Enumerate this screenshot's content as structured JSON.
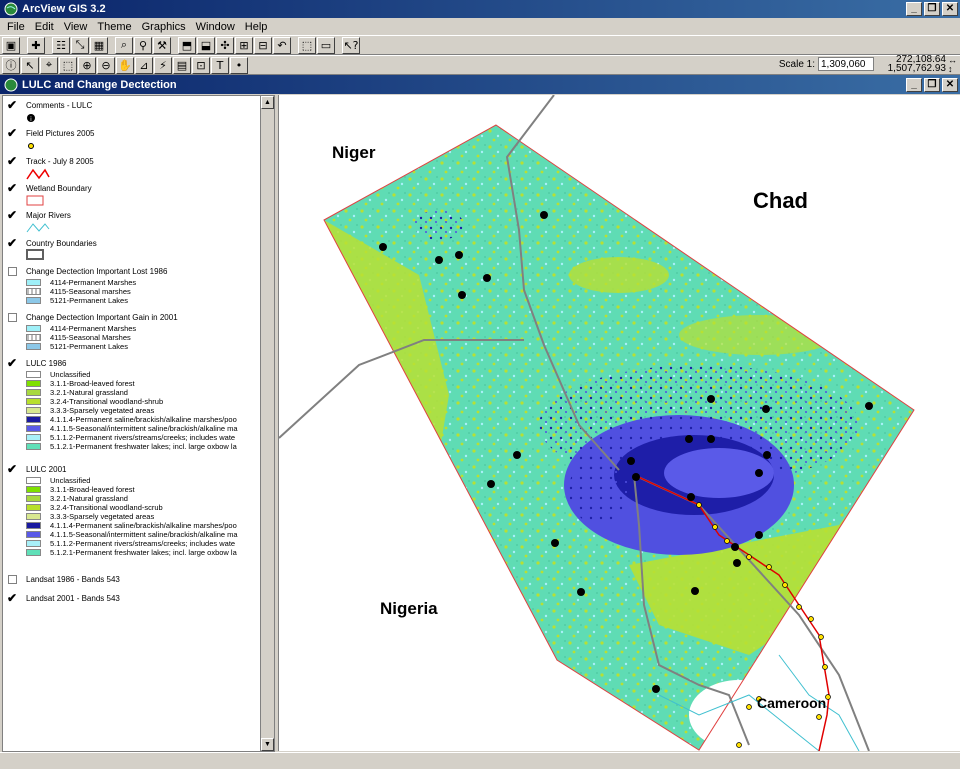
{
  "app": {
    "title": "ArcView GIS 3.2",
    "window_buttons": [
      "_",
      "❐",
      "✕"
    ]
  },
  "menu": [
    "File",
    "Edit",
    "View",
    "Theme",
    "Graphics",
    "Window",
    "Help"
  ],
  "toolbar": {
    "scale_label": "Scale 1:",
    "scale_value": "1,309,060",
    "coord_x": "272,108.64",
    "coord_y": "1,507,762.93"
  },
  "view": {
    "title": "LULC and Change Dectection"
  },
  "toc": {
    "layers": [
      {
        "name": "Comments - LULC",
        "checked": true
      },
      {
        "name": "Field Pictures 2005",
        "checked": true
      },
      {
        "name": "Track - July 8 2005",
        "checked": true
      },
      {
        "name": "Wetland Boundary",
        "checked": true
      },
      {
        "name": "Major Rivers",
        "checked": true
      },
      {
        "name": "Country Boundaries",
        "checked": true
      },
      {
        "name": "Change Dectection Important Lost 1986",
        "checked": false,
        "classes": [
          "4114-Permanent Marshes",
          "4115-Seasonal marshes",
          "5121-Permanent Lakes"
        ]
      },
      {
        "name": "Change Dectection Important Gain in 2001",
        "checked": false,
        "classes": [
          "4114-Permanent Marshes",
          "4115-Seasonal Marshes",
          "5121-Permanent Lakes"
        ]
      },
      {
        "name": "LULC 1986",
        "checked": true,
        "classes": [
          "Unclassified",
          "3.1.1-Broad-leaved forest",
          "3.2.1-Natural grassland",
          "3.2.4-Transitional woodland-shrub",
          "3.3.3-Sparsely vegetated areas",
          "4.1.1.4-Permanent saline/brackish/alkaline marshes/poo",
          "4.1.1.5-Seasonal/intermittent saline/brackish/alkaline ma",
          "5.1.1.2-Permanent rivers/streams/creeks; includes wate",
          "5.1.2.1-Permanent freshwater lakes; incl. large oxbow la"
        ]
      },
      {
        "name": "LULC 2001",
        "checked": true,
        "classes": [
          "Unclassified",
          "3.1.1-Broad-leaved forest",
          "3.2.1-Natural grassland",
          "3.2.4-Transitional woodland-scrub",
          "3.3.3-Sparsely vegetated areas",
          "4.1.1.4-Permanent saline/brackish/alkaline marshes/poo",
          "4.1.1.5-Seasonal/intermittent saline/brackish/alkaline ma",
          "5.1.1.2-Permanent rivers/streams/creeks; includes wate",
          "5.1.2.1-Permanent freshwater lakes; incl. large oxbow la"
        ]
      },
      {
        "name": "Landsat 1986 - Bands 543",
        "checked": false
      },
      {
        "name": "Landsat 2001 - Bands 543",
        "checked": true
      }
    ],
    "class_colors": [
      "#ffffff",
      "#7fe000",
      "#a8d840",
      "#b8e02c",
      "#d8e890",
      "#1a1aa0",
      "#5a5ae8",
      "#a8f0f8",
      "#60e0b8"
    ]
  },
  "map": {
    "labels": [
      "Niger",
      "Chad",
      "Nigeria",
      "Cameroon"
    ],
    "colors": {
      "grass": "#5fdcb4",
      "yellow": "#b8e032",
      "marsh": "#1e1ea8",
      "seasonal": "#5050e0",
      "boundary": "#808080",
      "track": "#e00000"
    }
  }
}
